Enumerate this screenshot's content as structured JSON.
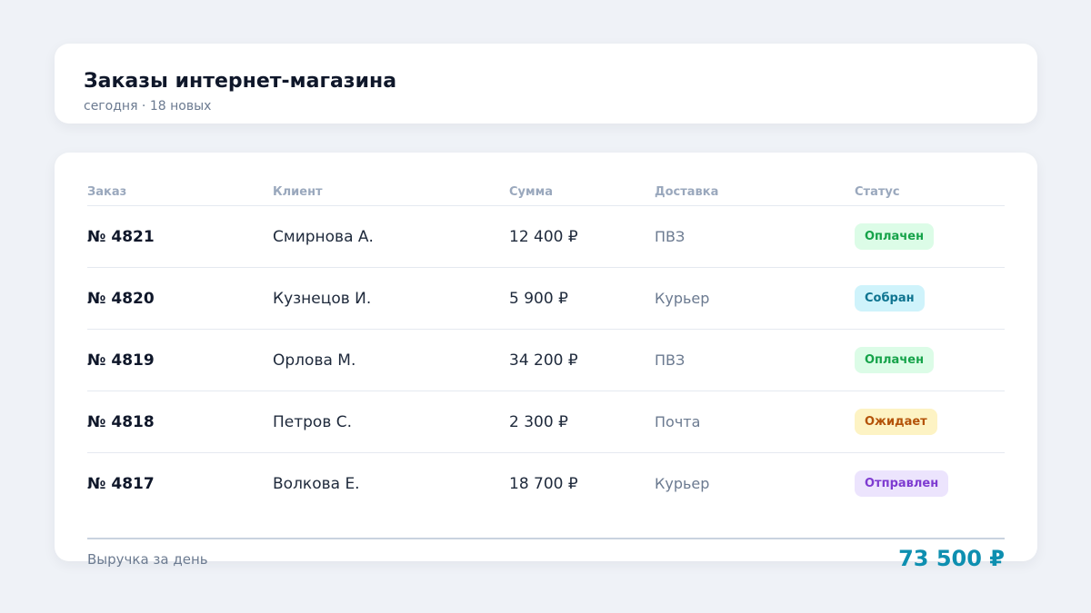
{
  "header": {
    "title": "Заказы интернет-магазина",
    "subtitle": "сегодня · 18 новых"
  },
  "table": {
    "columns": [
      "Заказ",
      "Клиент",
      "Сумма",
      "Доставка",
      "Статус"
    ],
    "rows": [
      {
        "order": "№ 4821",
        "client": "Смирнова А.",
        "amount": "12 400 ₽",
        "delivery": "ПВЗ",
        "status": "Оплачен"
      },
      {
        "order": "№ 4820",
        "client": "Кузнецов И.",
        "amount": "5 900 ₽",
        "delivery": "Курьер",
        "status": "Собран"
      },
      {
        "order": "№ 4819",
        "client": "Орлова М.",
        "amount": "34 200 ₽",
        "delivery": "ПВЗ",
        "status": "Оплачен"
      },
      {
        "order": "№ 4818",
        "client": "Петров С.",
        "amount": "2 300 ₽",
        "delivery": "Почта",
        "status": "Ожидает"
      },
      {
        "order": "№ 4817",
        "client": "Волкова Е.",
        "amount": "18 700 ₽",
        "delivery": "Курьер",
        "status": "Отправлен"
      }
    ]
  },
  "status_colors": {
    "paid": {
      "bg": "#dcfce7",
      "fg": "#16a34a"
    },
    "assembled": {
      "bg": "#cff3fb",
      "fg": "#0e7490"
    },
    "pending": {
      "bg": "#fdf3c4",
      "fg": "#b45309"
    },
    "shipped": {
      "bg": "#ece4fd",
      "fg": "#7e3bd1"
    }
  },
  "footer": {
    "label": "Выручка за день",
    "total": "73 500 ₽"
  },
  "colors": {
    "background": "#eff2f7",
    "accent": "#0e8fb0",
    "title": "#0f172a"
  }
}
